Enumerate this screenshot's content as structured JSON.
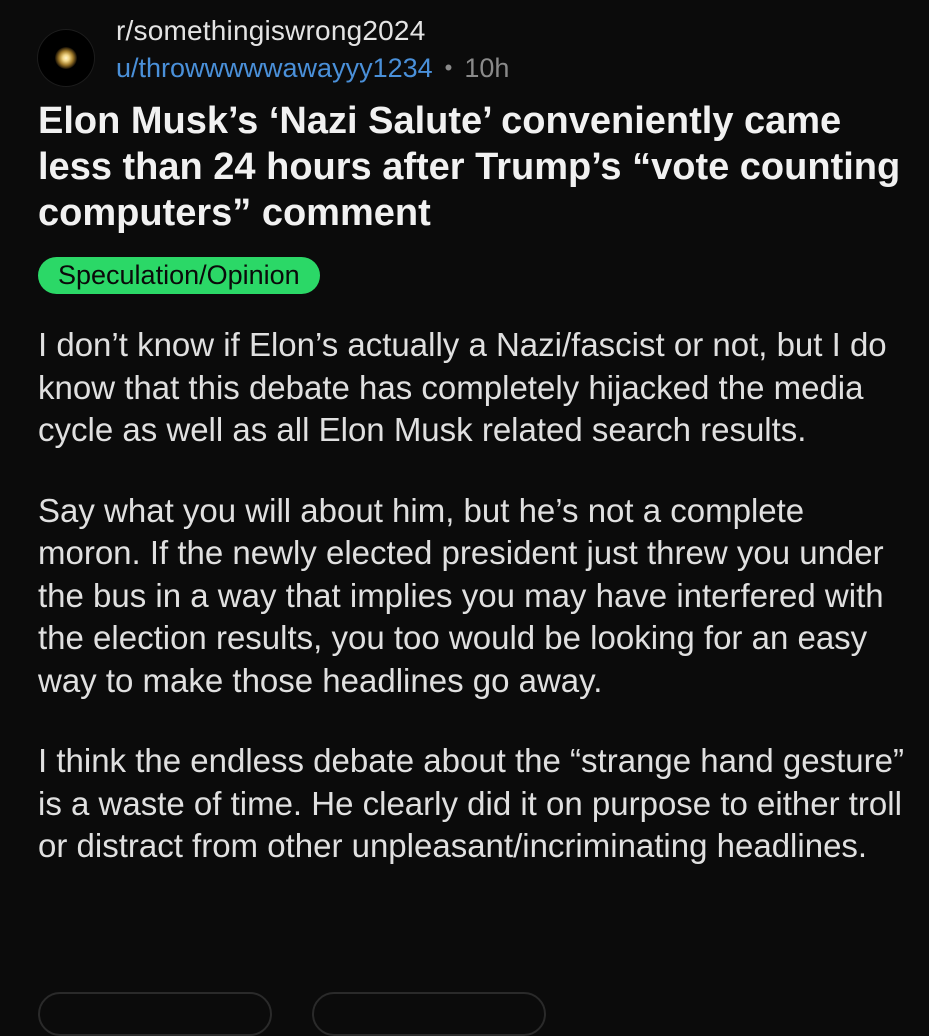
{
  "header": {
    "subreddit": "r/somethingiswrong2024",
    "username": "u/throwwwwwawayyy1234",
    "separator": "•",
    "time": "10h"
  },
  "post": {
    "title": "Elon Musk’s ‘Nazi Salute’ conveniently came less than 24 hours after Trump’s “vote counting computers” comment",
    "flair": "Speculation/Opinion",
    "paragraphs": [
      "I don’t know if Elon’s actually a Nazi/fascist or not, but I do know that this debate has completely hijacked the media cycle as well as all Elon Musk related search results.",
      "Say what you will about him, but he’s not a complete moron. If the newly elected president just threw you under the bus in a way that implies you may have interfered with the election results, you too would be looking for an easy way to make those headlines go away.",
      "I think the endless debate about the “strange hand gesture” is a waste of time. He clearly did it on purpose to either troll or distract from other unpleasant/incriminating headlines."
    ]
  },
  "colors": {
    "background": "#0b0b0b",
    "username": "#4a90d9",
    "flair": "#2bd867"
  }
}
